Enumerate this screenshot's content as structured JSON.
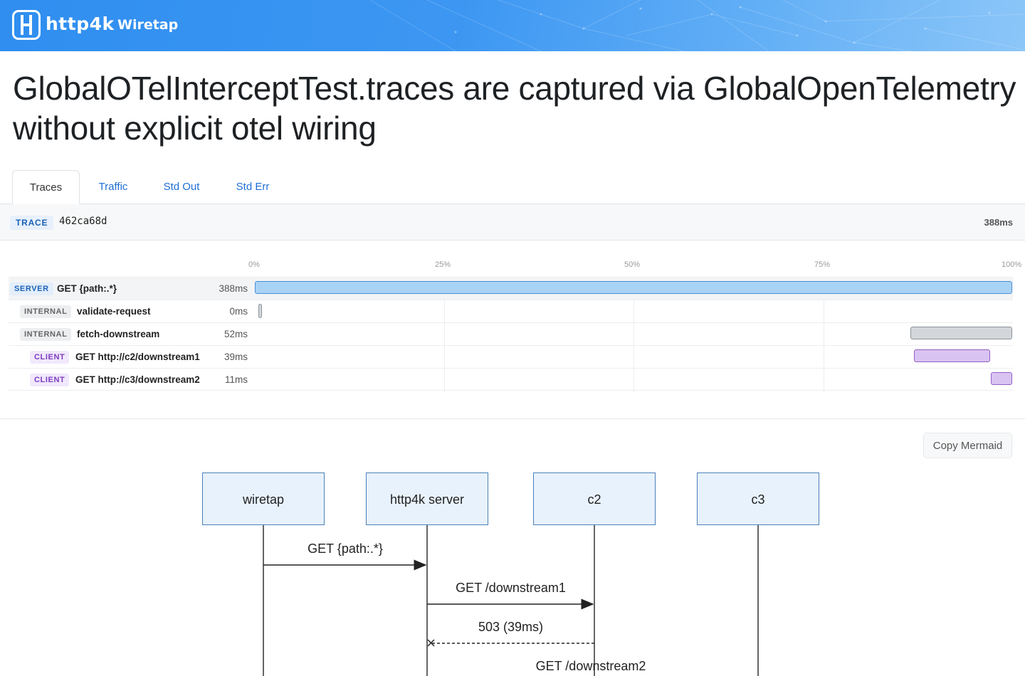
{
  "header": {
    "brand": "http4k",
    "subtitle": "Wiretap",
    "logo_icon": "http4k-logo-icon",
    "gradient_start": "#2f8ef0",
    "gradient_end": "#8cc6f8"
  },
  "page": {
    "title": "GlobalOTelInterceptTest.traces are captured via GlobalOpenTelemetry without explicit otel wiring"
  },
  "tabs": [
    {
      "label": "Traces",
      "active": true
    },
    {
      "label": "Traffic",
      "active": false
    },
    {
      "label": "Std Out",
      "active": false
    },
    {
      "label": "Std Err",
      "active": false
    }
  ],
  "trace": {
    "badge": "TRACE",
    "id": "462ca68d",
    "total": "388ms",
    "axis": [
      "0%",
      "25%",
      "50%",
      "75%",
      "100%"
    ],
    "spans": [
      {
        "kind": "SERVER",
        "name": "GET {path:.*}",
        "duration": "388ms",
        "start_pct": 0,
        "width_pct": 100
      },
      {
        "kind": "INTERNAL",
        "name": "validate-request",
        "duration": "0ms",
        "start_pct": 0.5,
        "width_pct": 0.3
      },
      {
        "kind": "INTERNAL",
        "name": "fetch-downstream",
        "duration": "52ms",
        "start_pct": 86.6,
        "width_pct": 13.4
      },
      {
        "kind": "CLIENT",
        "name": "GET http://c2/downstream1",
        "duration": "39ms",
        "start_pct": 87.0,
        "width_pct": 10.1
      },
      {
        "kind": "CLIENT",
        "name": "GET http://c3/downstream2",
        "duration": "11ms",
        "start_pct": 97.2,
        "width_pct": 2.8
      }
    ],
    "colors": {
      "server": "#a9d3f5",
      "internal": "#d3d7db",
      "client": "#d9c3f2"
    }
  },
  "mermaid": {
    "copy_label": "Copy Mermaid",
    "actors": [
      "wiretap",
      "http4k server",
      "c2",
      "c3"
    ],
    "messages": [
      {
        "text": "GET {path:.*}",
        "from": 0,
        "to": 1,
        "style": "solid"
      },
      {
        "text": "GET /downstream1",
        "from": 1,
        "to": 2,
        "style": "solid"
      },
      {
        "text": "503 (39ms)",
        "from": 2,
        "to": 1,
        "style": "dashed-cross"
      },
      {
        "text": "GET /downstream2",
        "from": 1,
        "to": 3,
        "style": "solid"
      }
    ]
  }
}
